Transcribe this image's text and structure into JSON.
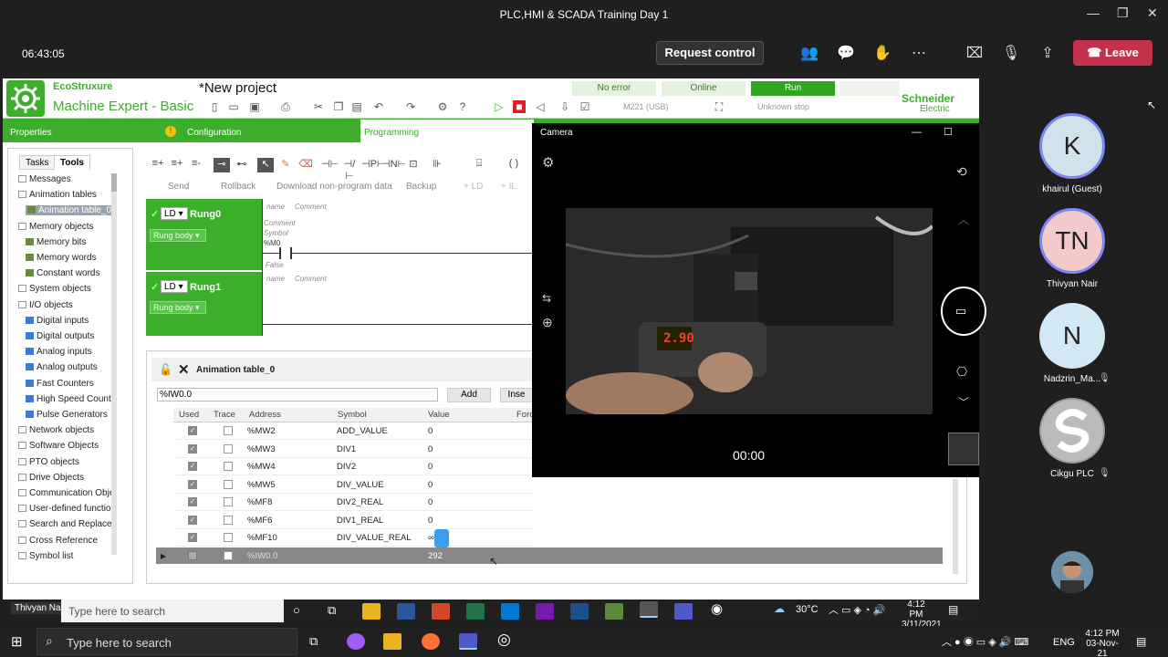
{
  "window": {
    "title": "PLC,HMI & SCADA Training Day 1"
  },
  "meeting": {
    "timer": "06:43:05",
    "request_control": "Request control",
    "leave": "Leave"
  },
  "ecostruxure": {
    "brand": "EcoStruxure",
    "product": "Machine Expert - Basic",
    "project": "*New project",
    "status": {
      "error": "No error",
      "online": "Online",
      "run": "Run",
      "device": "M221 (USB)",
      "stop": "Unknown stop"
    },
    "vendor_line1": "Schneider",
    "vendor_line2": "Electric",
    "tabs": {
      "properties": "Properties",
      "configuration": "Configuration",
      "programming": "Programming"
    },
    "left_tabs": [
      "Tasks",
      "Tools"
    ],
    "tree": [
      "Messages",
      "Animation tables",
      "Animation table_0",
      "Memory objects",
      "Memory bits",
      "Memory words",
      "Constant words",
      "System objects",
      "I/O objects",
      "Digital inputs",
      "Digital outputs",
      "Analog inputs",
      "Analog outputs",
      "Fast Counters",
      "High Speed Count",
      "Pulse Generators",
      "Network objects",
      "Software Objects",
      "PTO objects",
      "Drive Objects",
      "Communication Obje",
      "User-defined functior",
      "Search and Replace",
      "Cross Reference",
      "Symbol list"
    ],
    "ladder_buttons": [
      "Send",
      "Rollback",
      "Download non-program data",
      "Backup",
      "+ LD",
      "+ IL"
    ],
    "rungs": [
      {
        "name": "Rung0",
        "lang": "LD",
        "body": "Rung body",
        "label": "name",
        "comment": "Comment",
        "c2": "Comment",
        "sym": "Symbol",
        "addr": "%M0",
        "state": "False"
      },
      {
        "name": "Rung1",
        "lang": "LD",
        "body": "Rung body",
        "label": "name",
        "comment": "Comment"
      }
    ],
    "anim": {
      "title": "Animation table_0",
      "address_value": "%IW0.0",
      "add": "Add",
      "insert": "Inse",
      "columns": [
        "Used",
        "Trace",
        "Address",
        "Symbol",
        "Value",
        "Forc"
      ],
      "rows": [
        {
          "address": "%MW2",
          "symbol": "ADD_VALUE",
          "value": "0"
        },
        {
          "address": "%MW3",
          "symbol": "DIV1",
          "value": "0"
        },
        {
          "address": "%MW4",
          "symbol": "DIV2",
          "value": "0"
        },
        {
          "address": "%MW5",
          "symbol": "DIV_VALUE",
          "value": "0"
        },
        {
          "address": "%MF8",
          "symbol": "DIV2_REAL",
          "value": "0"
        },
        {
          "address": "%MF6",
          "symbol": "DIV1_REAL",
          "value": "0"
        },
        {
          "address": "%MF10",
          "symbol": "DIV_VALUE_REAL",
          "value": "∞"
        }
      ],
      "last_row": {
        "address": "%IW0.0",
        "value": "292"
      }
    }
  },
  "camera": {
    "title": "Camera",
    "time": "00:00",
    "display": "2.90"
  },
  "inner_taskbar": {
    "user": "Thivyan Nair",
    "search": "Type here to search",
    "temp": "30°C",
    "time": "4:12 PM",
    "date": "3/11/2021"
  },
  "outer_taskbar": {
    "search": "Type here to search",
    "lang": "ENG",
    "time": "4:12 PM",
    "date": "03-Nov-21"
  },
  "participants": [
    {
      "initials": "K",
      "name": "khairul (Guest)",
      "color": "#cfe3ea"
    },
    {
      "initials": "TN",
      "name": "Thivyan Nair",
      "color": "#f3c9c9"
    },
    {
      "initials": "N",
      "name": "Nadzrin_Ma...",
      "color": "#d3e8f5"
    },
    {
      "initials": "",
      "name": "Cikgu PLC",
      "color": "#9a9a9a"
    }
  ]
}
